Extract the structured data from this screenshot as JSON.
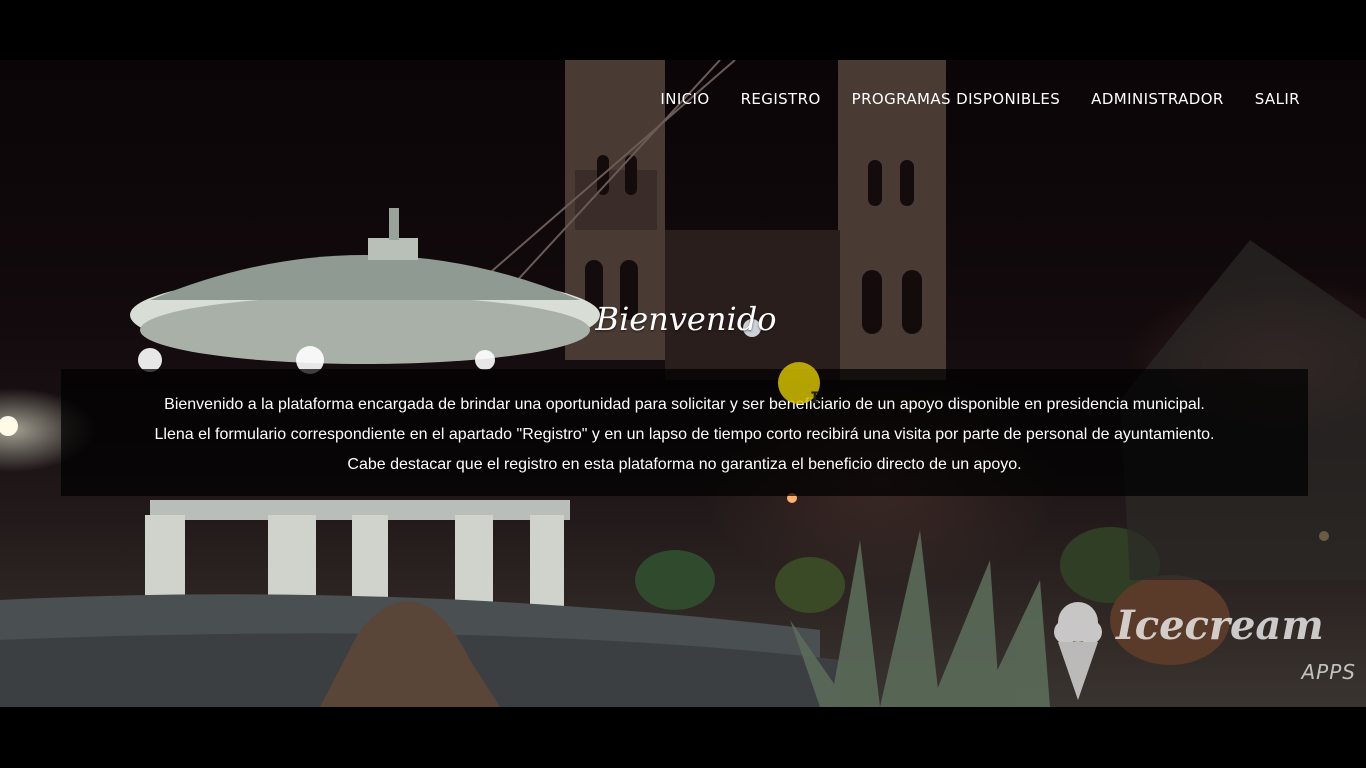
{
  "nav": {
    "items": [
      {
        "label": "INICIO"
      },
      {
        "label": "REGISTRO"
      },
      {
        "label": "PROGRAMAS DISPONIBLES"
      },
      {
        "label": "ADMINISTRADOR"
      },
      {
        "label": "SALIR"
      }
    ]
  },
  "hero": {
    "title": "Bienvenido",
    "paragraphs": [
      "Bienvenido a la plataforma encargada de brindar una oportunidad para solicitar y ser beneficiario de un apoyo disponible en presidencia municipal.",
      "Llena el formulario correspondiente en el apartado \"Registro\" y en un lapso de tiempo corto recibirá una visita por parte de personal de ayuntamiento.",
      "Cabe destacar que el registro en esta plataforma no garantiza el beneficio directo de un apoyo."
    ]
  },
  "watermark": {
    "brand": "Icecream",
    "sub": "APPS",
    "icon": "ice-cream-icon"
  },
  "colors": {
    "overlay": "#000000",
    "text": "#ffffff",
    "cursor_highlight": "#d2be00"
  }
}
